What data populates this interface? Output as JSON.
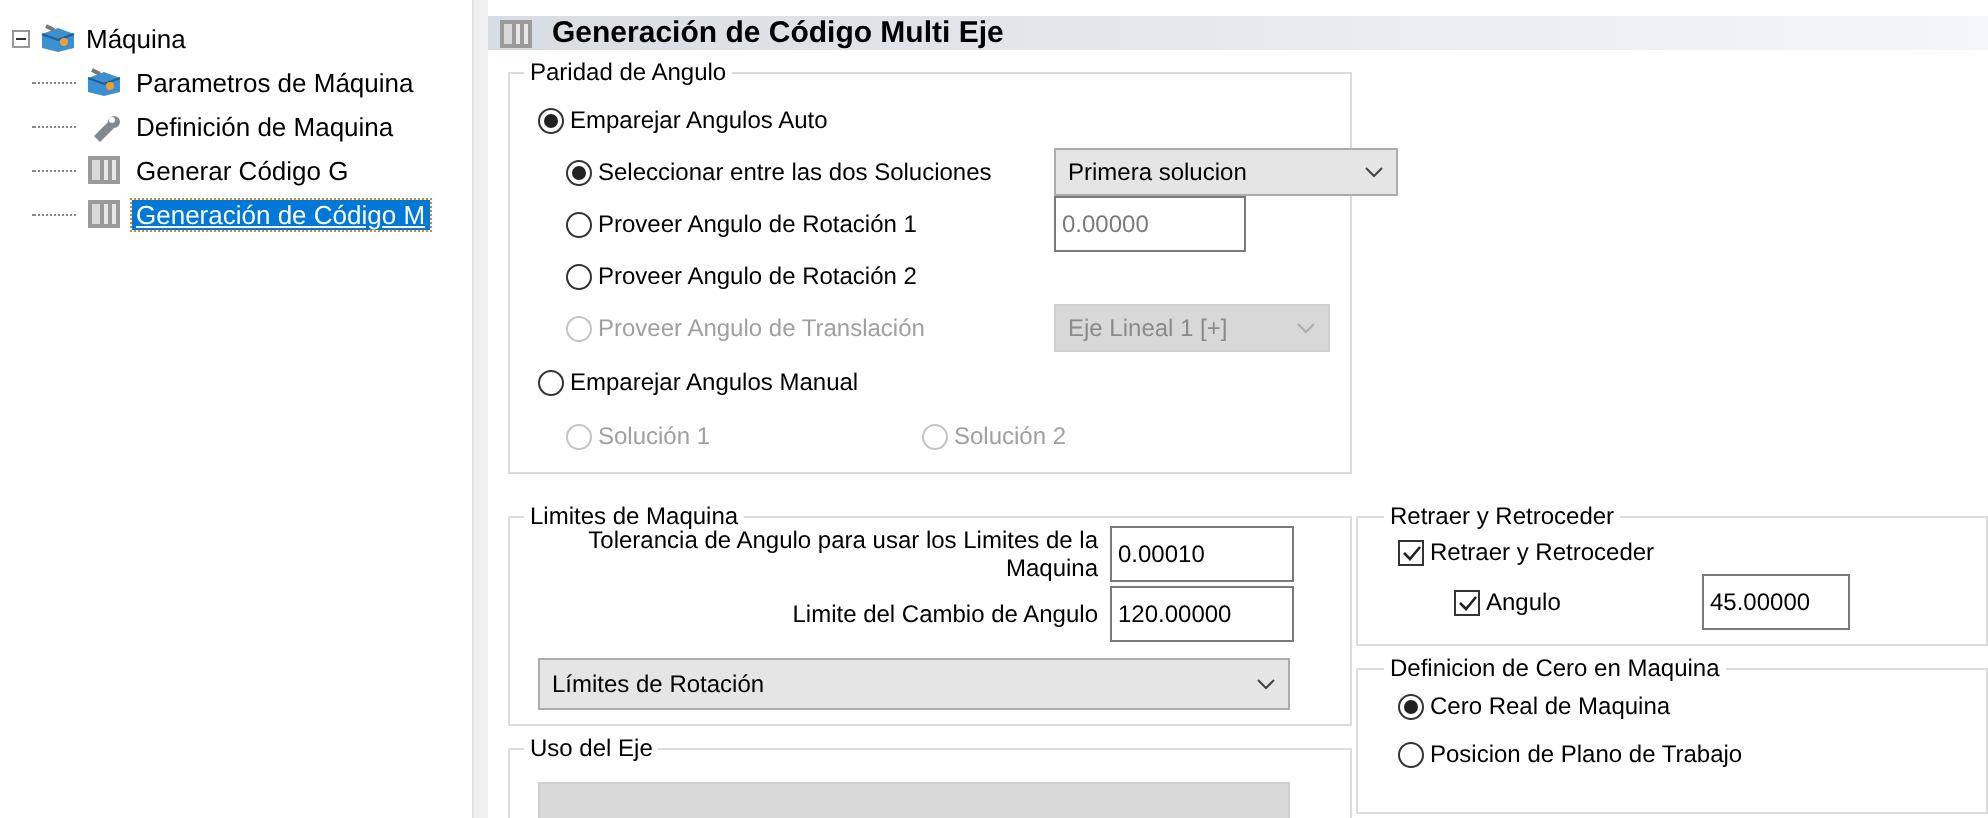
{
  "tree": {
    "label": "Máquina",
    "expanded": true,
    "children": [
      {
        "label": "Parametros de Máquina",
        "kind": "machine",
        "selected": false
      },
      {
        "label": "Definición de Maquina",
        "kind": "tool",
        "selected": false
      },
      {
        "label": "Generar Código G",
        "kind": "code",
        "selected": false
      },
      {
        "label": "Generación de Código M",
        "kind": "code",
        "selected": true
      }
    ]
  },
  "header": {
    "title": "Generación de Código Multi Eje"
  },
  "angle_pairing": {
    "title": "Paridad de Angulo",
    "auto": {
      "label": "Emparejar Angulos Auto",
      "selected": true,
      "choices": [
        {
          "label": "Seleccionar entre las dos Soluciones",
          "selected": true,
          "disabled": false
        },
        {
          "label": "Proveer Angulo de Rotación 1",
          "selected": false,
          "disabled": false
        },
        {
          "label": "Proveer Angulo de Rotación 2",
          "selected": false,
          "disabled": false
        },
        {
          "label": "Proveer Angulo de Translación",
          "selected": false,
          "disabled": true
        }
      ],
      "solution_select": {
        "value": "Primera solucion"
      },
      "angle_field": {
        "value": "0.00000",
        "disabled": true
      },
      "axis_select": {
        "value": "Eje Lineal 1 [+]",
        "disabled": true
      }
    },
    "manual": {
      "label": "Emparejar Angulos Manual",
      "selected": false,
      "choices": [
        {
          "label": "Solución 1",
          "selected": false,
          "disabled": true
        },
        {
          "label": "Solución 2",
          "selected": false,
          "disabled": true
        }
      ]
    }
  },
  "machine_limits": {
    "title": "Limites de Maquina",
    "tolerance_label": "Tolerancia de Angulo para usar los Limites de la Maquina",
    "tolerance_value": "0.00010",
    "change_label": "Limite del Cambio de Angulo",
    "change_value": "120.00000",
    "select": {
      "value": "Límites de Rotación"
    }
  },
  "axis_usage": {
    "title": "Uso del Eje"
  },
  "retract": {
    "title": "Retraer y Retroceder",
    "retract_check": {
      "label": "Retraer y Retroceder",
      "checked": true
    },
    "angle_check": {
      "label": "Angulo",
      "checked": true
    },
    "angle_value": "45.00000"
  },
  "machine_zero": {
    "title": "Definicion de Cero en Maquina",
    "options": [
      {
        "label": "Cero Real de Maquina",
        "selected": true
      },
      {
        "label": "Posicion de Plano de Trabajo",
        "selected": false
      }
    ]
  }
}
